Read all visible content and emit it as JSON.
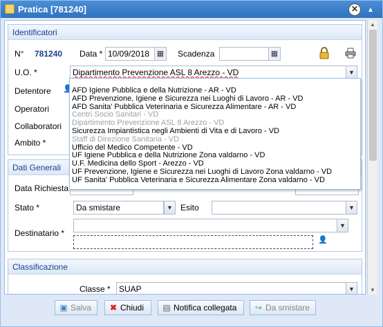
{
  "window": {
    "title": "Pratica [781240]"
  },
  "identificatori": {
    "header": "Identificatori",
    "numero_label": "N°",
    "numero_value": "781240",
    "data_label": "Data *",
    "data_value": "10/09/2018",
    "scadenza_label": "Scadenza",
    "scadenza_value": "",
    "uo_label": "U.O. *",
    "uo_value": "Dipartimento Prevenzione ASL 8 Arezzo - VD",
    "detentore_label": "Detentore",
    "operatori_label": "Operatori",
    "collaboratori_label": "Collaboratori",
    "ambito_label": "Ambito *"
  },
  "uo_dropdown": {
    "items": [
      {
        "label": "AFD Igiene Pubblica e della Nutrizione - AR - VD",
        "disabled": false
      },
      {
        "label": "AFD Prevenzione, Igiene e Sicurezza nei Luoghi di Lavoro - AR - VD",
        "disabled": false
      },
      {
        "label": "AFD Sanita' Pubblica Veterinaria e Sicurezza Alimentare - AR - VD",
        "disabled": false
      },
      {
        "label": "Centri Socio Sanitari - VD",
        "disabled": true
      },
      {
        "label": "Dipartimento Prevenzione ASL 8 Arezzo - VD",
        "disabled": true
      },
      {
        "label": "Sicurezza Impiantistica negli Ambienti di Vita e di Lavoro - VD",
        "disabled": false
      },
      {
        "label": "Staff di Direzione Sanitaria - VD",
        "disabled": true
      },
      {
        "label": "Ufficio del Medico Competente - VD",
        "disabled": false
      },
      {
        "label": "UF Igiene Pubblica e della Nutrizione Zona valdarno - VD",
        "disabled": false
      },
      {
        "label": "U.F. Medicina dello Sport - Arezzo - VD",
        "disabled": false
      },
      {
        "label": "UF Prevenzione, Igiene e Sicurezza nei Luoghi di Lavoro Zona valdarno - VD",
        "disabled": false
      },
      {
        "label": "UF Sanita' Pubblica Veterinaria e Sicurezza Alimentare Zona valdarno - VD",
        "disabled": false
      }
    ]
  },
  "dati_generali": {
    "header": "Dati Generali",
    "data_richiesta_label": "Data Richiesta",
    "stato_label": "Stato *",
    "stato_value": "Da smistare",
    "esito_label": "Esito",
    "esito_value": "",
    "destinatario_label": "Destinatario *"
  },
  "classificazione": {
    "header": "Classificazione",
    "classe_label": "Classe *",
    "classe_value": "SUAP"
  },
  "footer": {
    "salva": "Salva",
    "chiudi": "Chiudi",
    "notifica": "Notifica collegata",
    "smistare": "Da smistare"
  }
}
